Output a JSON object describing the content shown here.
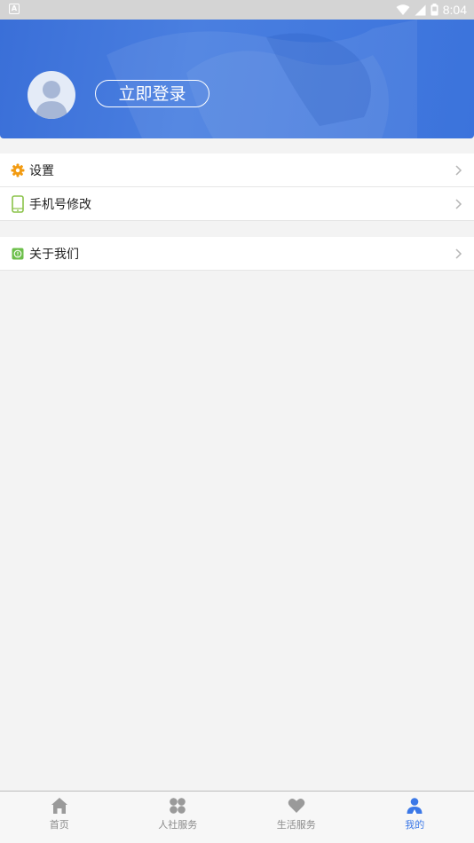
{
  "status_bar": {
    "time": "8:04"
  },
  "header": {
    "login_label": "立即登录"
  },
  "menu": {
    "group1": [
      {
        "label": "设置",
        "icon": "gear-icon"
      },
      {
        "label": "手机号修改",
        "icon": "phone-icon"
      }
    ],
    "group2": [
      {
        "label": "关于我们",
        "icon": "info-icon"
      }
    ]
  },
  "tabbar": {
    "active": "我的",
    "tabs": [
      {
        "label": "首页",
        "icon": "home-icon"
      },
      {
        "label": "人社服务",
        "icon": "services-icon"
      },
      {
        "label": "生活服务",
        "icon": "heart-icon"
      },
      {
        "label": "我的",
        "icon": "profile-icon"
      }
    ]
  },
  "colors": {
    "accent": "#3b78e7",
    "banner": "#3a6fd8",
    "gear": "#f29b12",
    "phone": "#8bc34a",
    "info": "#6dbf4b"
  }
}
